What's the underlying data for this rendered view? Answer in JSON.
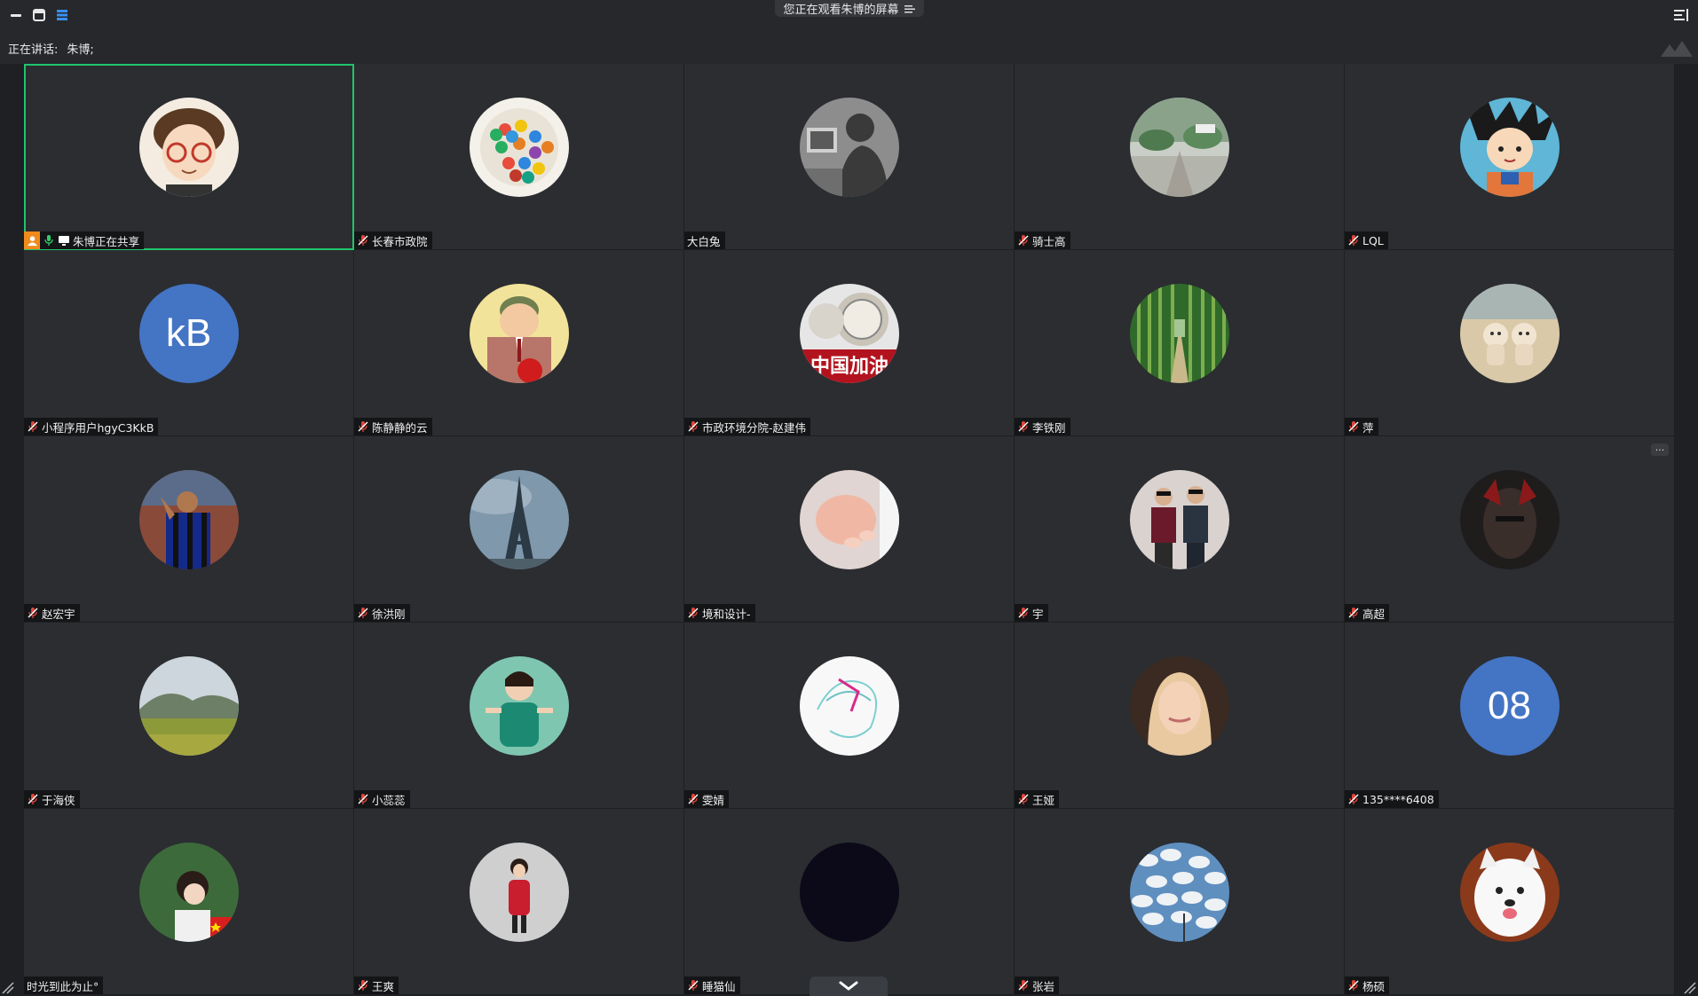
{
  "window": {
    "buttons": [
      {
        "name": "minimize-icon"
      },
      {
        "name": "window-icon"
      },
      {
        "name": "layout-icon"
      }
    ]
  },
  "share_banner": {
    "text": "您正在观看朱博的屏幕",
    "icon": "list-icon"
  },
  "speaking": {
    "label": "正在讲话:",
    "speaker": "朱博;"
  },
  "colors": {
    "accent_active": "#21c46b",
    "host_badge": "#f08a1c",
    "initials_bg": "#4474c4",
    "mic_off": "#e0463a"
  },
  "participants": [
    {
      "name": "朱博正在共享",
      "avatar": "cartoon-glasses",
      "host": true,
      "mic": "on",
      "sharing": true,
      "active": true
    },
    {
      "name": "长春市政院",
      "avatar": "candies",
      "mic": "off"
    },
    {
      "name": "大白兔",
      "avatar": "silhouette",
      "mic": "none"
    },
    {
      "name": "骑士高",
      "avatar": "garden",
      "mic": "off"
    },
    {
      "name": "LQL",
      "avatar": "anime-boy",
      "mic": "off"
    },
    {
      "name": "小程序用户hgyC3KkB",
      "avatar_text": "kB",
      "mic": "off"
    },
    {
      "name": "陈静静的云",
      "avatar": "cartoon-man",
      "mic": "off"
    },
    {
      "name": "市政环境分院-赵建伟",
      "avatar": "china-jiayou",
      "avatar_caption": "中国加油",
      "mic": "off"
    },
    {
      "name": "李铁刚",
      "avatar": "bamboo",
      "mic": "off"
    },
    {
      "name": "萍",
      "avatar": "toys",
      "mic": "off"
    },
    {
      "name": "赵宏宇",
      "avatar": "footballer",
      "mic": "off"
    },
    {
      "name": "徐洪刚",
      "avatar": "eiffel",
      "mic": "off"
    },
    {
      "name": "境和设计-",
      "avatar": "baby-hand",
      "mic": "off"
    },
    {
      "name": "宇",
      "avatar": "two-men",
      "mic": "off"
    },
    {
      "name": "高超",
      "avatar": "dark-figure",
      "mic": "off",
      "more": "..."
    },
    {
      "name": "于海侠",
      "avatar": "hills",
      "mic": "off"
    },
    {
      "name": "小蕊蕊",
      "avatar": "girl-green",
      "mic": "off"
    },
    {
      "name": "雯婧",
      "avatar": "sketch",
      "mic": "off"
    },
    {
      "name": "王娅",
      "avatar": "blonde",
      "mic": "off"
    },
    {
      "name": "135****6408",
      "avatar_text": "08",
      "mic": "off"
    },
    {
      "name": "时光到此为止°",
      "avatar": "girl-flag",
      "mic": "none"
    },
    {
      "name": "王爽",
      "avatar": "girl-red",
      "mic": "off"
    },
    {
      "name": "睡猫仙",
      "avatar": "dark",
      "mic": "off"
    },
    {
      "name": "张岩",
      "avatar": "sky-clouds",
      "mic": "off"
    },
    {
      "name": "杨硕",
      "avatar": "samoyed",
      "mic": "off"
    }
  ]
}
